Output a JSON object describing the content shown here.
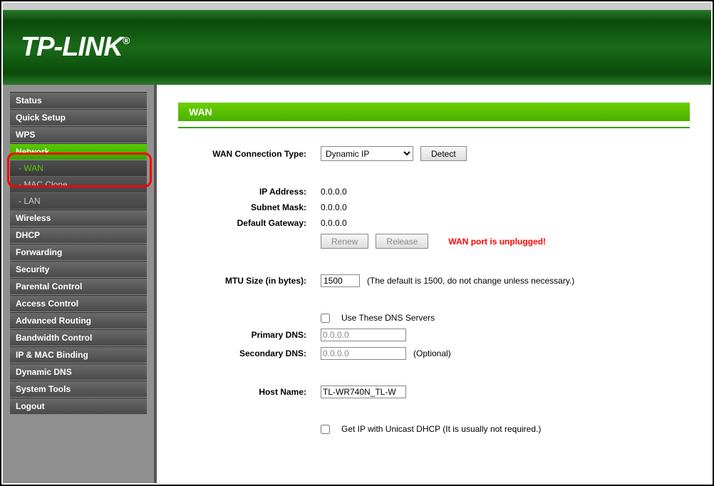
{
  "header": {
    "brand": "TP-LINK"
  },
  "sidebar": {
    "items": [
      "Status",
      "Quick Setup",
      "WPS",
      "Network",
      "Wireless",
      "DHCP",
      "Forwarding",
      "Security",
      "Parental Control",
      "Access Control",
      "Advanced Routing",
      "Bandwidth Control",
      "IP & MAC Binding",
      "Dynamic DNS",
      "System Tools",
      "Logout"
    ],
    "network_subs": [
      "- WAN",
      "- MAC Clone",
      "- LAN"
    ]
  },
  "page": {
    "title": "WAN"
  },
  "wan": {
    "conn_type_label": "WAN Connection Type:",
    "conn_type_value": "Dynamic IP",
    "detect_btn": "Detect",
    "ip_label": "IP Address:",
    "ip_value": "0.0.0.0",
    "mask_label": "Subnet Mask:",
    "mask_value": "0.0.0.0",
    "gw_label": "Default Gateway:",
    "gw_value": "0.0.0.0",
    "renew_btn": "Renew",
    "release_btn": "Release",
    "warning": "WAN port is unplugged!",
    "mtu_label": "MTU Size (in bytes):",
    "mtu_value": "1500",
    "mtu_note": "(The default is 1500, do not change unless necessary.)",
    "dns_check_label": "Use These DNS Servers",
    "pdns_label": "Primary DNS:",
    "pdns_value": "0.0.0.0",
    "sdns_label": "Secondary DNS:",
    "sdns_value": "0.0.0.0",
    "sdns_note": "(Optional)",
    "host_label": "Host Name:",
    "host_value": "TL-WR740N_TL-W",
    "unicast_label": "Get IP with Unicast DHCP (It is usually not required.)"
  }
}
